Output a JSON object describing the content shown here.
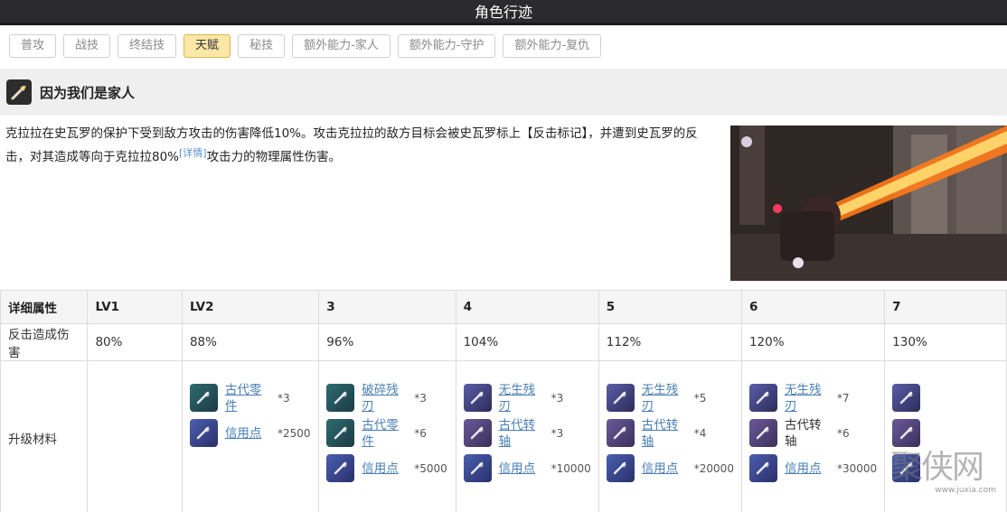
{
  "window": {
    "title": "角色行迹"
  },
  "tabs": [
    {
      "label": "普攻",
      "active": false
    },
    {
      "label": "战技",
      "active": false
    },
    {
      "label": "终结技",
      "active": false
    },
    {
      "label": "天赋",
      "active": true
    },
    {
      "label": "秘技",
      "active": false
    },
    {
      "label": "额外能力-家人",
      "active": false
    },
    {
      "label": "额外能力-守护",
      "active": false
    },
    {
      "label": "额外能力-复仇",
      "active": false
    }
  ],
  "talent": {
    "icon": "talent-flashlight-icon",
    "name": "因为我们是家人",
    "description_part1": "克拉拉在史瓦罗的保护下受到敌方攻击的伤害降低10%。攻击克拉拉的敌方目标会被史瓦罗标上【反击标记】，并遭到史瓦罗的反击，对其造成等向于克拉拉80%",
    "detail_link": "[详情]",
    "description_part2": "攻击力的物理属性伤害。"
  },
  "table": {
    "headers": [
      "详细属性",
      "LV1",
      "LV2",
      "3",
      "4",
      "5",
      "6",
      "7"
    ],
    "row_damage": {
      "label": "反击造成伤害",
      "values": [
        "80%",
        "88%",
        "96%",
        "104%",
        "112%",
        "120%",
        "130%"
      ]
    },
    "row_materials": {
      "label": "升级材料",
      "levels": [
        [],
        [
          {
            "name": "古代零件",
            "count": "*3",
            "icon": "mi-teal",
            "link": true
          },
          {
            "name": "信用点",
            "count": "*2500",
            "icon": "mi-blue",
            "link": true
          }
        ],
        [
          {
            "name": "破碎残刃",
            "count": "*3",
            "icon": "mi-teal",
            "link": true
          },
          {
            "name": "古代零件",
            "count": "*6",
            "icon": "mi-teal",
            "link": true
          },
          {
            "name": "信用点",
            "count": "*5000",
            "icon": "mi-blue",
            "link": true
          }
        ],
        [
          {
            "name": "无生残刃",
            "count": "*3",
            "icon": "mi-purple",
            "link": true
          },
          {
            "name": "古代转轴",
            "count": "*3",
            "icon": "mi-gold",
            "link": true
          },
          {
            "name": "信用点",
            "count": "*10000",
            "icon": "mi-blue",
            "link": true
          }
        ],
        [
          {
            "name": "无生残刃",
            "count": "*5",
            "icon": "mi-purple",
            "link": true
          },
          {
            "name": "古代转轴",
            "count": "*4",
            "icon": "mi-gold",
            "link": true
          },
          {
            "name": "信用点",
            "count": "*20000",
            "icon": "mi-blue",
            "link": true
          }
        ],
        [
          {
            "name": "无生残刃",
            "count": "*7",
            "icon": "mi-purple",
            "link": true
          },
          {
            "name": "古代转轴",
            "count": "*6",
            "icon": "mi-gold",
            "link": false
          },
          {
            "name": "信用点",
            "count": "*30000",
            "icon": "mi-blue",
            "link": true
          }
        ],
        [
          {
            "name": "",
            "count": "",
            "icon": "mi-purple",
            "link": false
          },
          {
            "name": "",
            "count": "",
            "icon": "mi-gold",
            "link": false
          },
          {
            "name": "",
            "count": "",
            "icon": "mi-blue",
            "link": false
          }
        ]
      ]
    }
  },
  "watermark": {
    "text": "聚侠网",
    "url": "www.juxia.com"
  }
}
